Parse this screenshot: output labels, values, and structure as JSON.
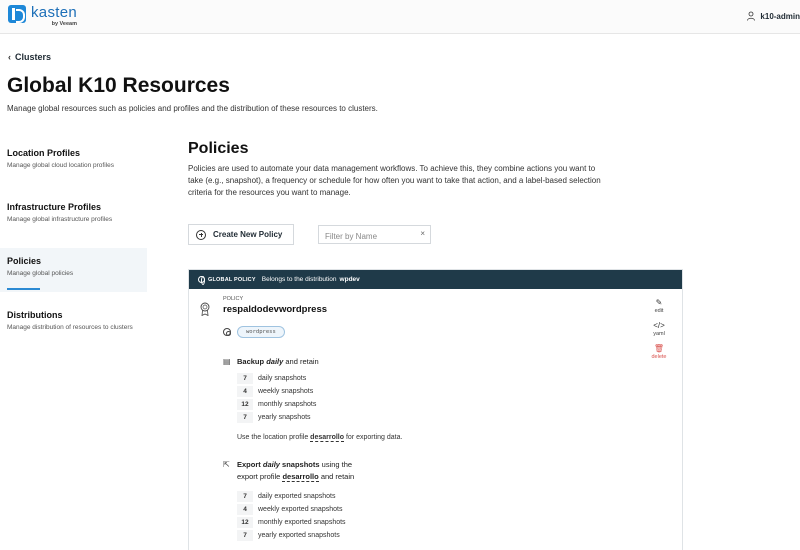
{
  "topbar": {
    "brand": "kasten",
    "brand_sub": "by Veeam",
    "user": "k10-admin"
  },
  "header": {
    "breadcrumb": "Clusters",
    "title": "Global K10 Resources",
    "subtitle": "Manage global resources such as policies and profiles and the distribution of these resources to clusters."
  },
  "sidebar": {
    "items": [
      {
        "title": "Location Profiles",
        "sub": "Manage global cloud location profiles"
      },
      {
        "title": "Infrastructure Profiles",
        "sub": "Manage global infrastructure profiles"
      },
      {
        "title": "Policies",
        "sub": "Manage global policies",
        "active": true
      },
      {
        "title": "Distributions",
        "sub": "Manage distribution of resources to clusters"
      }
    ]
  },
  "main": {
    "title": "Policies",
    "description": "Policies are used to automate your data management workflows. To achieve this, they combine actions you want to take (e.g., snapshot), a frequency or schedule for how often you want to take that action, and a label-based selection criteria for the resources you want to manage.",
    "create_label": "Create New Policy",
    "filter_placeholder": "Filter by Name",
    "filter_clear": "×"
  },
  "policy": {
    "badge": "GLOBAL POLICY",
    "belongs_text": "Belongs to the distribution",
    "distribution": "wpdev",
    "label": "POLICY",
    "name": "respaldodevwordpress",
    "actions": {
      "edit": "edit",
      "yaml": "yaml",
      "delete": "delete"
    },
    "selector_tag": "wordpress",
    "backup": {
      "prefix": "Backup",
      "frequency": "daily",
      "suffix": "and retain",
      "retention": [
        {
          "count": "7",
          "label": "daily snapshots"
        },
        {
          "count": "4",
          "label": "weekly snapshots"
        },
        {
          "count": "12",
          "label": "monthly snapshots"
        },
        {
          "count": "7",
          "label": "yearly snapshots"
        }
      ],
      "location_prefix": "Use the location profile",
      "location_profile": "desarrollo",
      "location_suffix": "for exporting data."
    },
    "export": {
      "prefix": "Export",
      "frequency": "daily",
      "what": "snapshots",
      "using": "using the",
      "profile_prefix": "export profile",
      "profile": "desarrollo",
      "suffix": "and retain",
      "retention": [
        {
          "count": "7",
          "label": "daily exported snapshots"
        },
        {
          "count": "4",
          "label": "weekly exported snapshots"
        },
        {
          "count": "12",
          "label": "monthly exported snapshots"
        },
        {
          "count": "7",
          "label": "yearly exported snapshots"
        }
      ]
    }
  }
}
